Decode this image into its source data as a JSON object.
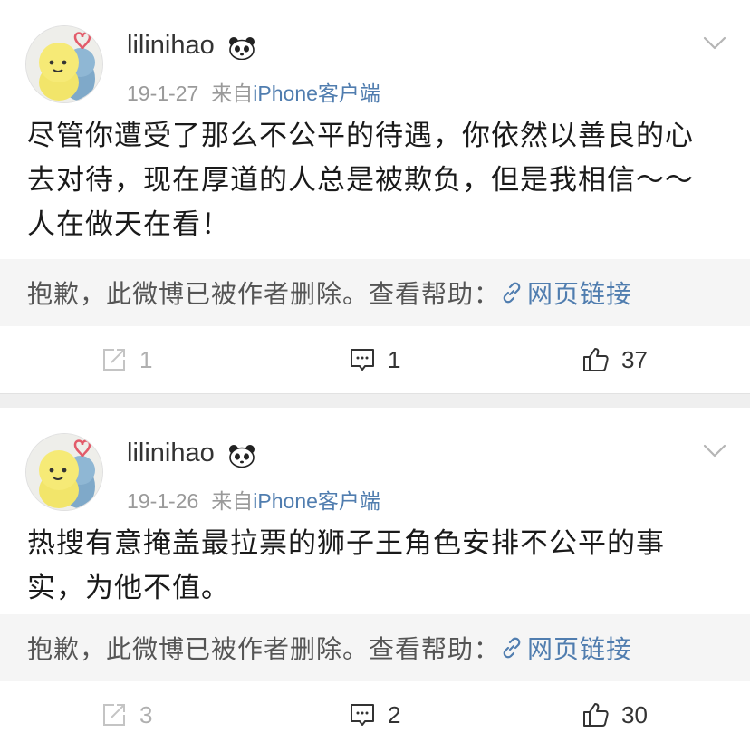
{
  "posts": [
    {
      "username": "lilinihao",
      "date": "19-1-27",
      "from_label": "来自",
      "source": "iPhone客户端",
      "content": "尽管你遭受了那么不公平的待遇，你依然以善良的心去对待，现在厚道的人总是被欺负，但是我相信～～人在做天在看！",
      "deleted_notice": "抱歉，此微博已被作者删除。查看帮助：",
      "link_label": "网页链接",
      "repost_count": "1",
      "comment_count": "1",
      "like_count": "37"
    },
    {
      "username": "lilinihao",
      "date": "19-1-26",
      "from_label": "来自",
      "source": "iPhone客户端",
      "content": "热搜有意掩盖最拉票的狮子王角色安排不公平的事实，为他不值。",
      "deleted_notice": "抱歉，此微博已被作者删除。查看帮助：",
      "link_label": "网页链接",
      "repost_count": "3",
      "comment_count": "2",
      "like_count": "30"
    }
  ],
  "icons": {
    "avatar": "avatar",
    "badge": "panda-icon",
    "menu": "chevron-down-icon",
    "link": "link-icon",
    "repost": "repost-icon",
    "comment": "comment-icon",
    "like": "thumbs-up-icon"
  },
  "colors": {
    "link": "#507daf",
    "meta": "#9a9a9a",
    "deleted_bg": "#f5f5f5",
    "separator": "#efefef"
  }
}
